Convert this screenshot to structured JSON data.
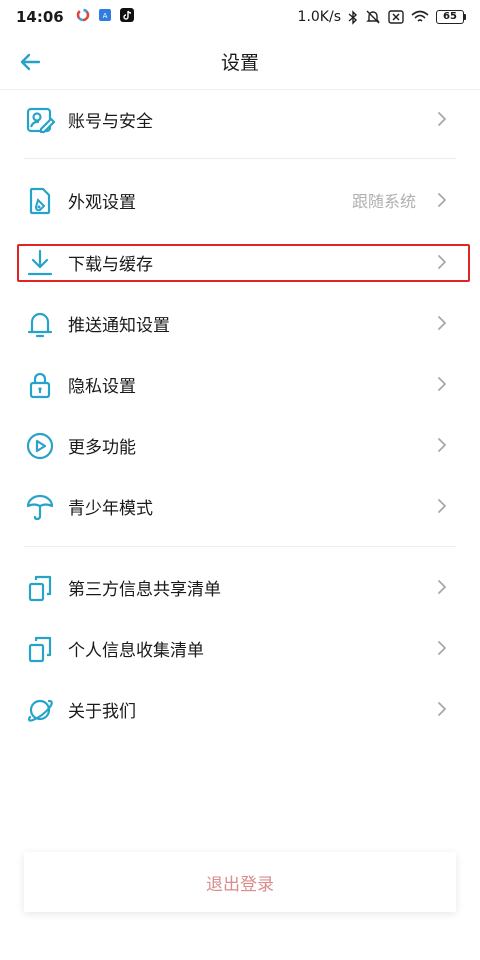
{
  "status_bar": {
    "time": "14:06",
    "network_speed": "1.0K/s",
    "battery_level": "65"
  },
  "header": {
    "title": "设置",
    "back_icon": "arrow-left-icon"
  },
  "menu": {
    "account_security": {
      "label": "账号与安全",
      "icon": "account-edit-icon"
    },
    "appearance": {
      "label": "外观设置",
      "value": "跟随系统",
      "icon": "phone-brush-icon"
    },
    "download_cache": {
      "label": "下载与缓存",
      "icon": "download-icon"
    },
    "push_notifications": {
      "label": "推送通知设置",
      "icon": "bell-icon"
    },
    "privacy": {
      "label": "隐私设置",
      "icon": "lock-icon"
    },
    "more_features": {
      "label": "更多功能",
      "icon": "play-circle-icon"
    },
    "youth_mode": {
      "label": "青少年模式",
      "icon": "umbrella-icon"
    },
    "third_party_share": {
      "label": "第三方信息共享清单",
      "icon": "copy-icon"
    },
    "personal_info": {
      "label": "个人信息收集清单",
      "icon": "copy-icon"
    },
    "about": {
      "label": "关于我们",
      "icon": "planet-icon"
    }
  },
  "logout": {
    "label": "退出登录"
  },
  "colors": {
    "accent": "#27a3c9",
    "highlight_border": "#e02424",
    "logout_text": "#d98c8c",
    "value_text": "#b0b0b0"
  }
}
